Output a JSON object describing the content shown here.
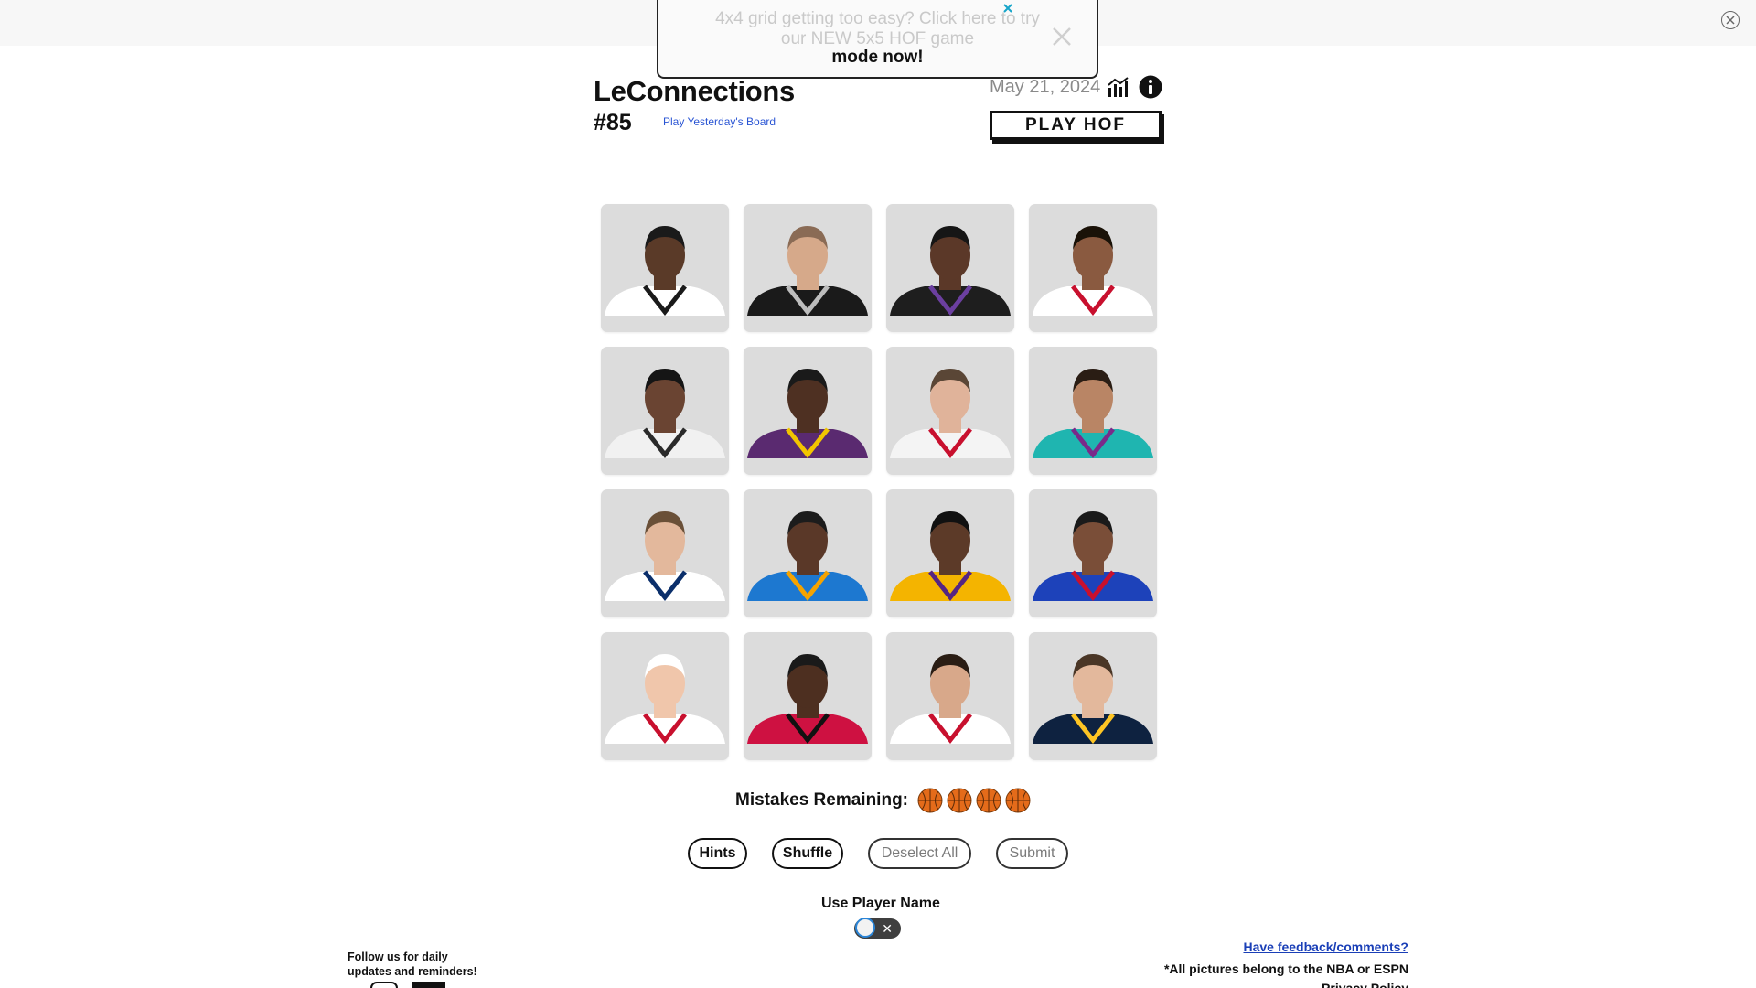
{
  "notice": {
    "faded_text": "4x4 grid getting too easy? Click here to try our NEW 5x5 HOF game",
    "bold_text": "mode now!"
  },
  "header": {
    "title": "LeConnections",
    "puzzle_number": "#85",
    "yesterday_link": "Play Yesterday's Board",
    "date": "May 21, 2024",
    "hof_button": "PLAY HOF"
  },
  "grid": {
    "tiles": [
      {
        "skin": "#5a3a28",
        "hair": "#1a1a1a",
        "jersey": "#ffffff",
        "trim": "#1a1a1a"
      },
      {
        "skin": "#d6a98a",
        "hair": "#8a6b55",
        "jersey": "#1a1a1a",
        "trim": "#bdbdbd"
      },
      {
        "skin": "#5b3828",
        "hair": "#161616",
        "jersey": "#1e1e1e",
        "trim": "#6b3fa0"
      },
      {
        "skin": "#8a5a40",
        "hair": "#1a1208",
        "jersey": "#ffffff",
        "trim": "#c8102e"
      },
      {
        "skin": "#6a4432",
        "hair": "#151515",
        "jersey": "#f1f1f1",
        "trim": "#2a2a2a"
      },
      {
        "skin": "#4e3022",
        "hair": "#1a1a1a",
        "jersey": "#5a2a70",
        "trim": "#f2c500"
      },
      {
        "skin": "#e0b39a",
        "hair": "#5a4636",
        "jersey": "#f4f4f4",
        "trim": "#c8102e"
      },
      {
        "skin": "#b98565",
        "hair": "#2a1d14",
        "jersey": "#1fb5b0",
        "trim": "#7a2a8a"
      },
      {
        "skin": "#e3b89c",
        "hair": "#6a5038",
        "jersey": "#ffffff",
        "trim": "#0b2f6b"
      },
      {
        "skin": "#5a3828",
        "hair": "#1c1c1c",
        "jersey": "#1d78d0",
        "trim": "#f5a300"
      },
      {
        "skin": "#5c3a28",
        "hair": "#111111",
        "jersey": "#f4b400",
        "trim": "#552583"
      },
      {
        "skin": "#7a4e38",
        "hair": "#1a1a1a",
        "jersey": "#1d42ba",
        "trim": "#c8102e"
      },
      {
        "skin": "#f0c6ab",
        "hair": "#ffffff",
        "jersey": "#ffffff",
        "trim": "#c8102e"
      },
      {
        "skin": "#4d2f20",
        "hair": "#1a1a1a",
        "jersey": "#ce1141",
        "trim": "#111111"
      },
      {
        "skin": "#d8a88a",
        "hair": "#2a1d14",
        "jersey": "#ffffff",
        "trim": "#c8102e"
      },
      {
        "skin": "#e3b89c",
        "hair": "#4a3626",
        "jersey": "#0e2240",
        "trim": "#fec524"
      }
    ]
  },
  "mistakes": {
    "label": "Mistakes Remaining:",
    "remaining": 4,
    "ball_color": "#e46b1a"
  },
  "buttons": {
    "hints": "Hints",
    "shuffle": "Shuffle",
    "deselect": "Deselect All",
    "submit": "Submit"
  },
  "toggle": {
    "label": "Use Player Name",
    "state": "off",
    "off_glyph": "✕"
  },
  "footer": {
    "follow": "Follow us for daily updates and reminders!",
    "feedback": "Have feedback/comments?",
    "credits": "*All pictures belong to the NBA or ESPN",
    "policy": "Privacy Policy"
  }
}
